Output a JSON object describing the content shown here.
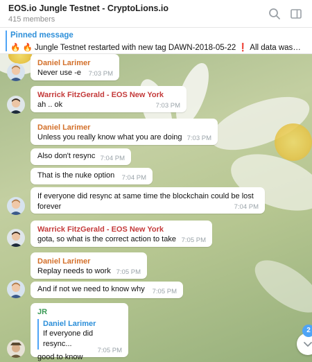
{
  "header": {
    "title": "EOS.io Jungle Testnet - CryptoLions.io",
    "members": "415 members",
    "search_icon": "search-icon",
    "sidebar_icon": "sidebar-toggle-icon"
  },
  "pinned": {
    "label": "Pinned message",
    "text": "🔥 🔥 Jungle Testnet restarted with new tag DAWN-2018-05-22 ❗ All data was rem..."
  },
  "messages": [
    {
      "sender": "Daniel Larimer",
      "text": "Never use -e",
      "time": "7:03 PM"
    },
    {
      "sender": "Warrick FitzGerald - EOS New York",
      "text": "ah .. ok",
      "time": "7:03 PM"
    },
    {
      "sender": "Daniel Larimer",
      "text": "Unless you really know what you are doing",
      "time": "7:03 PM"
    },
    {
      "sender": "",
      "text": "Also don't resync",
      "time": "7:04 PM"
    },
    {
      "sender": "",
      "text": "That is the nuke option",
      "time": "7:04 PM"
    },
    {
      "sender": "",
      "text": "If everyone did resync at same time the blockchain could be lost forever",
      "time": "7:04 PM"
    },
    {
      "sender": "Warrick FitzGerald - EOS New York",
      "text": "gota, so what is the correct action to take",
      "time": "7:05 PM"
    },
    {
      "sender": "Daniel Larimer",
      "text": "Replay needs to work",
      "time": "7:05 PM"
    },
    {
      "sender": "",
      "text": "And if not we need to know why",
      "time": "7:05 PM"
    },
    {
      "sender": "JR",
      "reply_to": "Daniel Larimer",
      "reply_text": "If everyone did resync...",
      "text": "good to know",
      "time": "7:05 PM"
    }
  ],
  "scroll_badge": "2",
  "colors": {
    "accent": "#4ea4f6",
    "daniel": "#d36f29",
    "warrick": "#c43a3a",
    "jr": "#3a9a55"
  }
}
